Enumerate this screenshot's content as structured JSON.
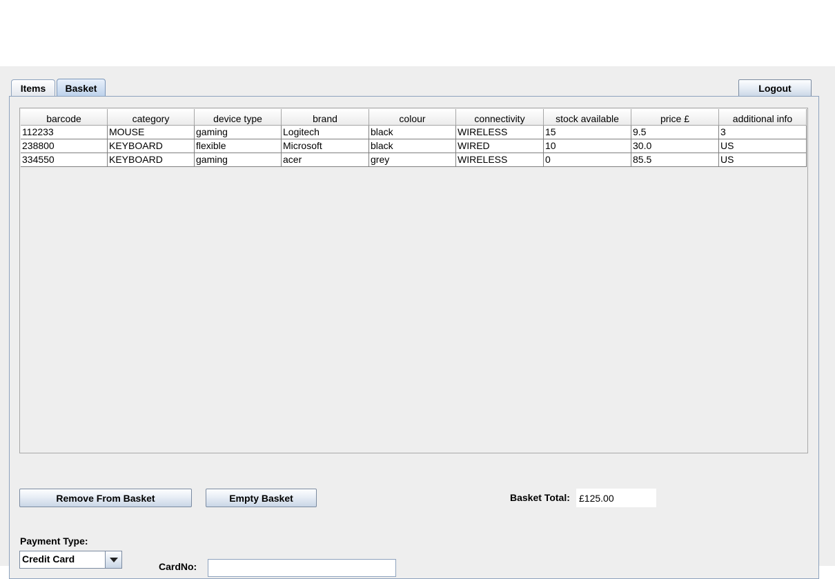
{
  "tabs": [
    {
      "label": "Items",
      "selected": false
    },
    {
      "label": "Basket",
      "selected": true
    }
  ],
  "logout_label": "Logout",
  "table": {
    "columns": [
      "barcode",
      "category",
      "device type",
      "brand",
      "colour",
      "connectivity",
      "stock available",
      "price £",
      "additional info"
    ],
    "rows": [
      [
        "112233",
        "MOUSE",
        "gaming",
        "Logitech",
        "black",
        "WIRELESS",
        "15",
        "9.5",
        "3"
      ],
      [
        "238800",
        "KEYBOARD",
        "flexible",
        "Microsoft",
        "black",
        "WIRED",
        "10",
        "30.0",
        "US"
      ],
      [
        "334550",
        "KEYBOARD",
        "gaming",
        "acer",
        "grey",
        "WIRELESS",
        "0",
        "85.5",
        "US"
      ]
    ]
  },
  "buttons": {
    "remove": "Remove From Basket",
    "empty": "Empty Basket"
  },
  "basket_total": {
    "label": "Basket Total:",
    "value": "£125.00"
  },
  "payment": {
    "label": "Payment Type:",
    "selected": "Credit Card"
  },
  "card_no": {
    "label": "CardNo:",
    "value": ""
  },
  "colors": {
    "background": "#eeeeee",
    "accent_border": "#8da2bd",
    "selected_tab": "#bcd1ea"
  }
}
